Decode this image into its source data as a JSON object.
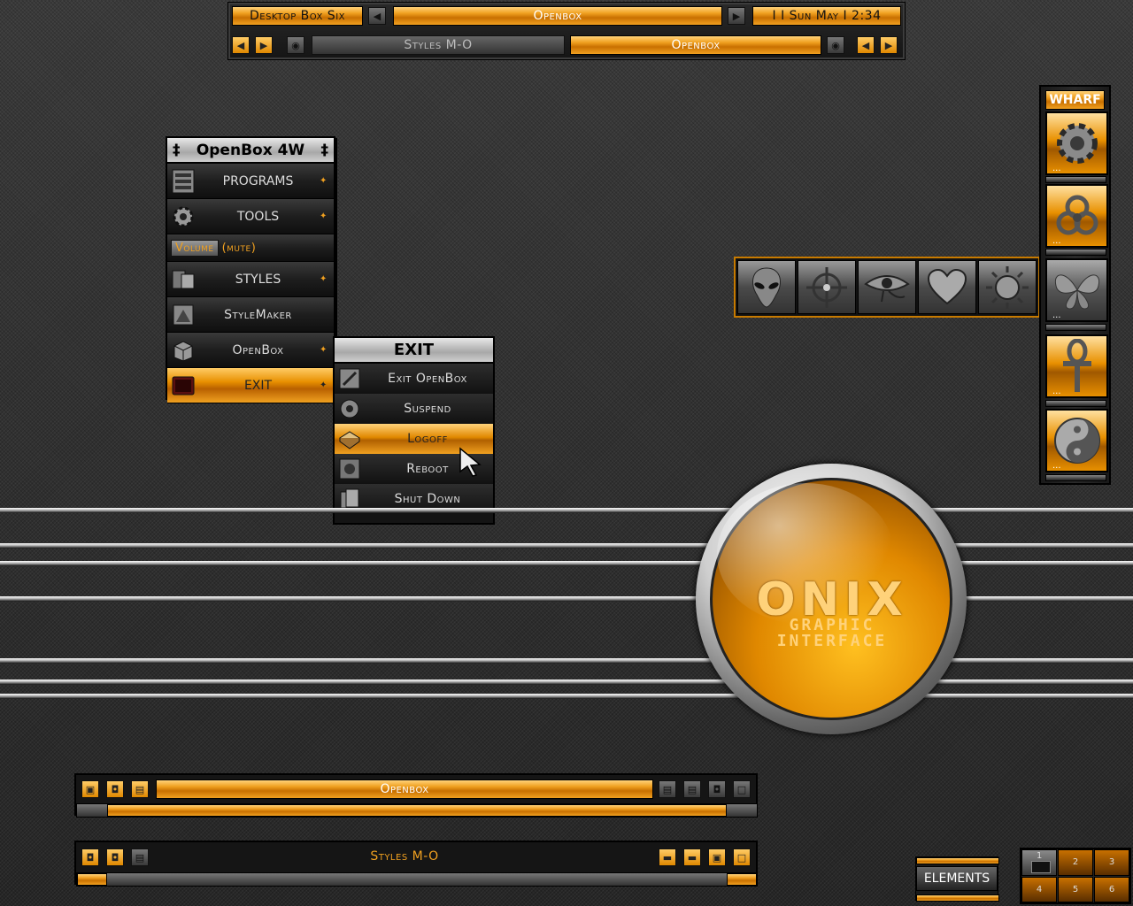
{
  "top_toolbar": {
    "workspace_name": "Desktop Box Six",
    "window_title": "Openbox",
    "clock": "I I   Sun May I 2:34",
    "row2_left_label": "Styles M-O",
    "row2_right_label": "Openbox"
  },
  "root_menu": {
    "title": "OpenBox 4W",
    "title_left_glyph": "‡",
    "title_right_glyph": "‡",
    "items": [
      {
        "label": "PROGRAMS",
        "icon": "filing-cabinet-icon",
        "submenu": true
      },
      {
        "label": "TOOLS",
        "icon": "gear-icon",
        "submenu": true
      },
      {
        "label": "Volume",
        "label_suffix": "(mute)",
        "icon": "",
        "submenu": false
      },
      {
        "label": "STYLES",
        "icon": "style-icon",
        "submenu": true
      },
      {
        "label": "StyleMaker",
        "icon": "style-maker-icon",
        "submenu": false
      },
      {
        "label": "OpenBox",
        "icon": "box-icon",
        "submenu": true
      },
      {
        "label": "EXIT",
        "icon": "exit-icon",
        "submenu": true,
        "active": true
      }
    ]
  },
  "exit_menu": {
    "title": "EXIT",
    "items": [
      {
        "label": "Exit OpenBox",
        "icon": "exit-openbox-icon"
      },
      {
        "label": "Suspend",
        "icon": "suspend-icon"
      },
      {
        "label": "Logoff",
        "icon": "logoff-icon",
        "active": true
      },
      {
        "label": "Reboot",
        "icon": "reboot-icon"
      },
      {
        "label": "Shut Down",
        "icon": "shutdown-icon"
      }
    ]
  },
  "wharf": {
    "title": "WHARF",
    "items": [
      "gear-icon",
      "biohazard-icon",
      "butterfly-icon",
      "ankh-icon",
      "yin-yang-icon"
    ],
    "dots": "..."
  },
  "icon_dock": {
    "items": [
      "alien-icon",
      "crosshair-icon",
      "eye-of-horus-icon",
      "heart-icon",
      "sun-icon"
    ]
  },
  "logo": {
    "title": "ONIX",
    "line1": "GRAPHIC",
    "line2": "INTERFACE"
  },
  "bottom_window_1": {
    "title": "Openbox"
  },
  "bottom_window_2": {
    "title": "Styles M-O"
  },
  "elements_button": {
    "label": "ELEMENTS"
  },
  "pager": {
    "desktops": [
      "1",
      "2",
      "3",
      "4",
      "5",
      "6"
    ],
    "current": "1"
  },
  "colors": {
    "accent": "#f0a020",
    "accent_dark": "#b86000",
    "background": "#2e2e2e"
  }
}
